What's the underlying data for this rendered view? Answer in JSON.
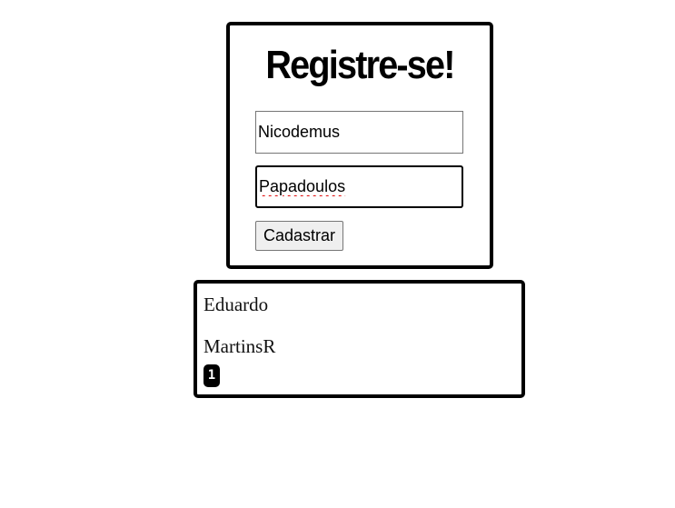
{
  "form": {
    "title": "Registre-se!",
    "first_name_value": "Nicodemus",
    "last_name_value": "Papadoulos",
    "submit_label": "Cadastrar"
  },
  "entries": [
    {
      "first_name": "Eduardo",
      "last_name": "MartinsR",
      "badge": "1"
    }
  ]
}
